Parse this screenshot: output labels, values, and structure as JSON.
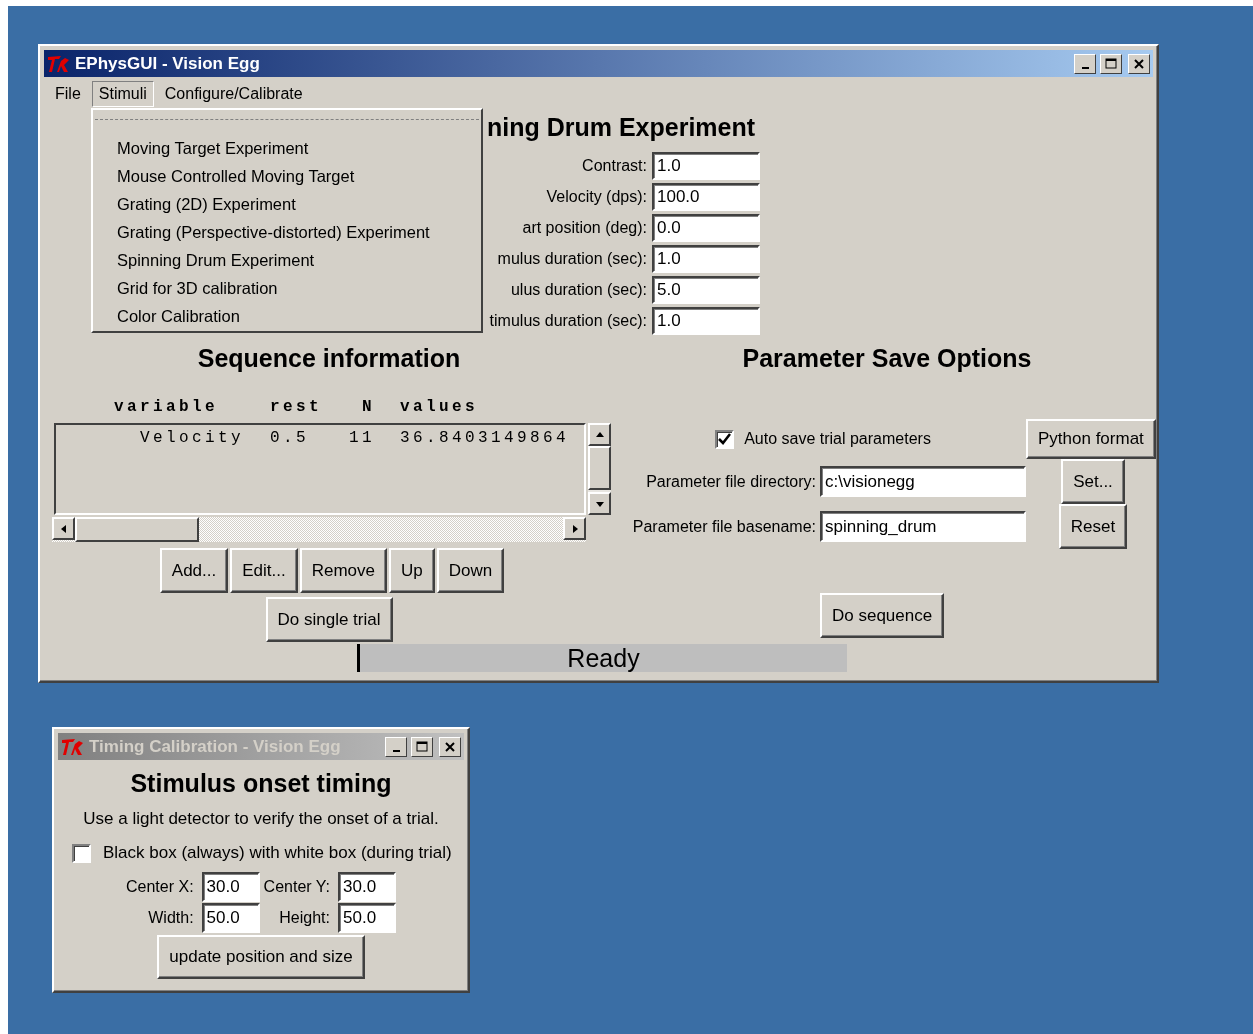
{
  "main_window": {
    "title": "EPhysGUI - Vision Egg",
    "active": true,
    "menu_bar": [
      {
        "label": "File",
        "selected": false
      },
      {
        "label": "Stimuli",
        "selected": true
      },
      {
        "label": "Configure/Calibrate",
        "selected": false
      }
    ],
    "stimuli_menu": {
      "items": [
        "Moving Target Experiment",
        "Mouse Controlled Moving Target",
        "Grating (2D) Experiment",
        "Grating (Perspective-distorted) Experiment",
        "Spinning Drum Experiment",
        "Grid for 3D calibration",
        "Color Calibration"
      ]
    },
    "experiment_form": {
      "heading": "ning Drum Experiment",
      "fields": [
        {
          "label": "Contrast:",
          "value": "1.0"
        },
        {
          "label": "Velocity (dps):",
          "value": "100.0"
        },
        {
          "label": "art position (deg):",
          "value": "0.0"
        },
        {
          "label": "mulus duration (sec):",
          "value": "1.0"
        },
        {
          "label": "ulus duration (sec):",
          "value": "5.0"
        },
        {
          "label": "timulus duration (sec):",
          "value": "1.0"
        }
      ]
    },
    "sequence": {
      "heading": "Sequence information",
      "columns": [
        "variable",
        "rest",
        "N",
        "values"
      ],
      "rows": [
        [
          "Velocity",
          "0.5",
          "11",
          "36.8403149864"
        ]
      ],
      "buttons": [
        "Add...",
        "Edit...",
        "Remove",
        "Up",
        "Down"
      ],
      "run_button": "Do single trial"
    },
    "save_options": {
      "heading": "Parameter Save Options",
      "auto_save": {
        "label": "Auto save trial parameters",
        "checked": true
      },
      "format_button": "Python format",
      "directory": {
        "label": "Parameter file directory:",
        "value": "c:\\visionegg"
      },
      "set_button": "Set...",
      "basename": {
        "label": "Parameter file basename:",
        "value": "spinning_drum"
      },
      "reset_button": "Reset",
      "run_button": "Do sequence"
    },
    "status": "Ready"
  },
  "timing_window": {
    "title": "Timing Calibration - Vision Egg",
    "active": false,
    "heading": "Stimulus onset timing",
    "instructions": "Use a light detector to verify the onset of a trial.",
    "box_option": {
      "label": "Black box (always) with white box (during trial)",
      "checked": false
    },
    "fields": [
      {
        "label": "Center X:",
        "value": "30.0"
      },
      {
        "label": "Center Y:",
        "value": "30.0"
      },
      {
        "label": "Width:",
        "value": "50.0"
      },
      {
        "label": "Height:",
        "value": "50.0"
      }
    ],
    "update_button": "update position and size"
  }
}
